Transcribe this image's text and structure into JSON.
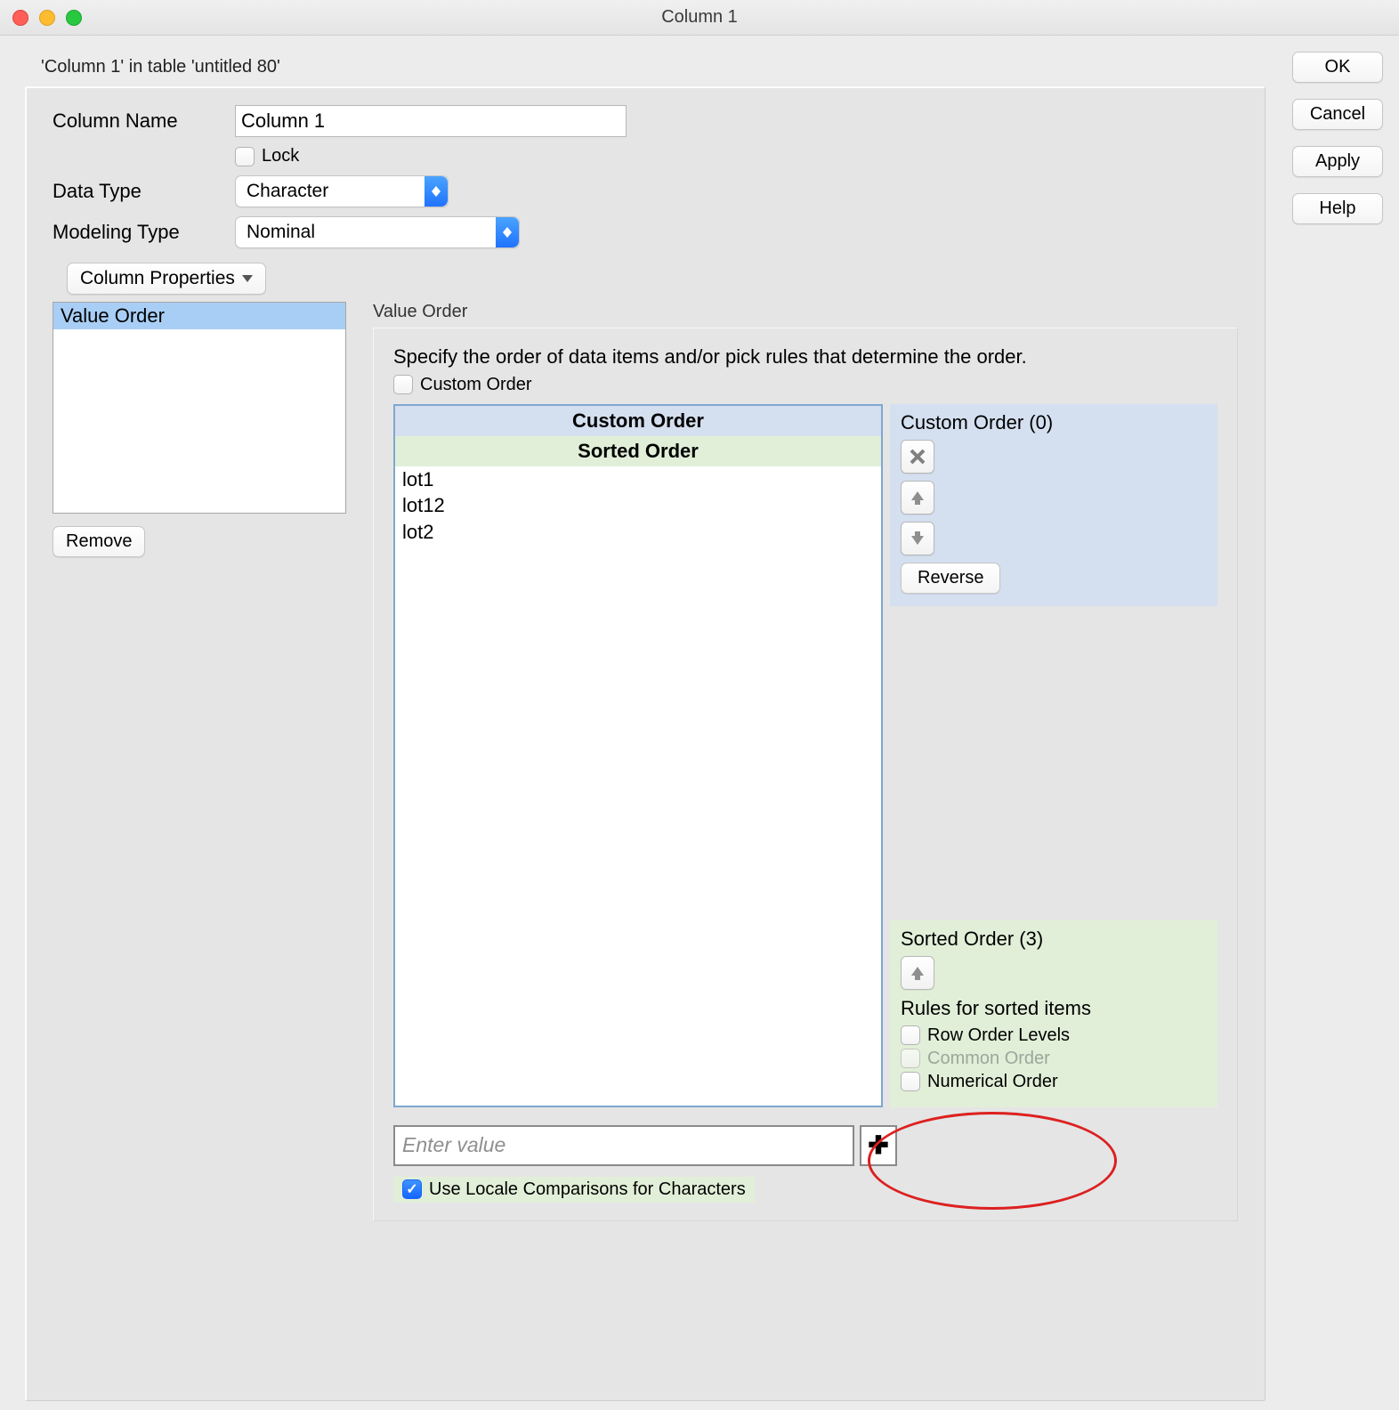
{
  "title": "Column 1",
  "breadcrumb": "'Column 1' in table 'untitled 80'",
  "form": {
    "column_name_label": "Column Name",
    "column_name_value": "Column 1",
    "lock_label": "Lock",
    "lock_checked": false,
    "data_type_label": "Data Type",
    "data_type_value": "Character",
    "modeling_type_label": "Modeling Type",
    "modeling_type_value": "Nominal"
  },
  "column_properties_button": "Column Properties",
  "properties_list_item": "Value Order",
  "remove_button": "Remove",
  "value_order": {
    "section_label": "Value Order",
    "intro": "Specify the order of data items and/or pick rules that determine the order.",
    "custom_order_checkbox": "Custom Order",
    "custom_order_header": "Custom Order",
    "sorted_order_header": "Sorted Order",
    "items": [
      "lot1",
      "lot12",
      "lot2"
    ],
    "custom_panel_title": "Custom Order (0)",
    "reverse_button": "Reverse",
    "sorted_panel_title": "Sorted Order (3)",
    "rules_title": "Rules for sorted items",
    "rule_row_order": "Row Order Levels",
    "rule_common_order": "Common Order",
    "rule_numerical_order": "Numerical Order",
    "enter_value_placeholder": "Enter value",
    "use_locale_label": "Use Locale Comparisons for Characters"
  },
  "side_buttons": {
    "ok": "OK",
    "cancel": "Cancel",
    "apply": "Apply",
    "help": "Help"
  }
}
